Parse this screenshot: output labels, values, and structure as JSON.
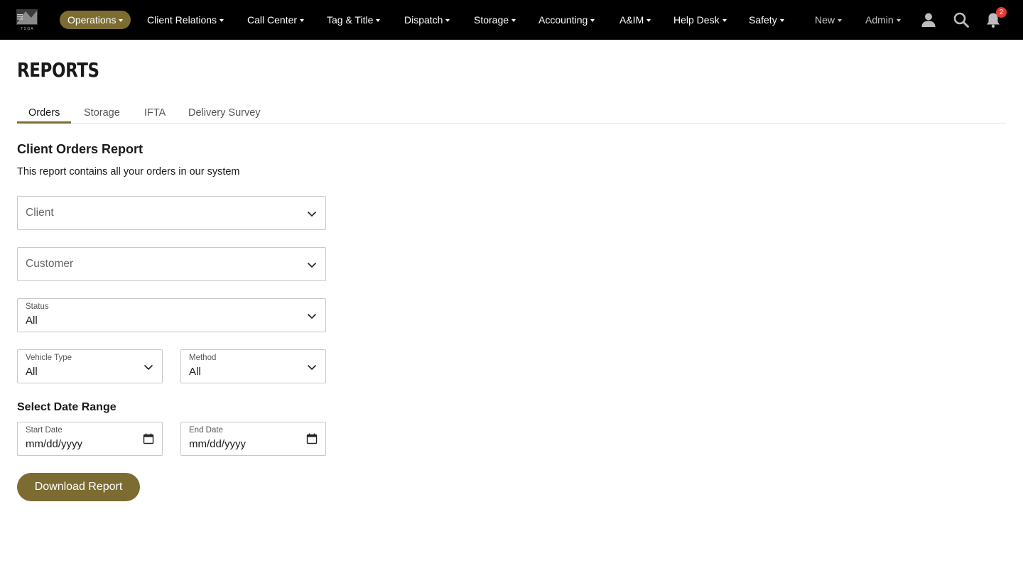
{
  "nav": {
    "logo_text": "T S G A",
    "items": [
      {
        "label": "Operations"
      },
      {
        "label": "Client Relations"
      },
      {
        "label": "Call Center"
      },
      {
        "label": "Tag & Title"
      },
      {
        "label": "Dispatch"
      },
      {
        "label": "Storage"
      },
      {
        "label": "Accounting"
      },
      {
        "label": "A&IM"
      },
      {
        "label": "Help Desk"
      },
      {
        "label": "Safety"
      },
      {
        "label": "New"
      },
      {
        "label": "Admin"
      }
    ],
    "icons": [
      "user-icon",
      "search-icon",
      "bell-icon"
    ],
    "notification_count": "2",
    "active_color": "#7d6c31"
  },
  "page": {
    "title": "REPORTS",
    "tabs": [
      {
        "label": "Orders",
        "active": true
      },
      {
        "label": "Storage"
      },
      {
        "label": "IFTA"
      },
      {
        "label": "Delivery Survey"
      }
    ]
  },
  "report": {
    "title": "Client Orders Report",
    "description": "This report contains all your orders in our system",
    "client": {
      "placeholder": "Client"
    },
    "customer": {
      "placeholder": "Customer"
    },
    "status": {
      "label": "Status",
      "value": "All"
    },
    "vehicle_type": {
      "label": "Vehicle Type",
      "value": "All"
    },
    "method": {
      "label": "Method",
      "value": "All"
    },
    "date_range_title": "Select Date Range",
    "start_date": {
      "label": "Start Date",
      "value": "mm/dd/yyyy"
    },
    "end_date": {
      "label": "End Date",
      "value": "mm/dd/yyyy"
    },
    "download_label": "Download Report"
  }
}
